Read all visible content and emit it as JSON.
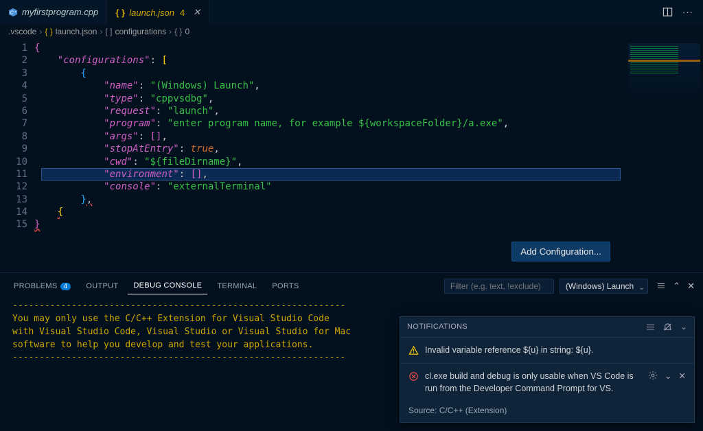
{
  "tabs": [
    {
      "label": "myfirstprogram.cpp",
      "icon": "cpp-icon",
      "active": false
    },
    {
      "label": "launch.json",
      "icon": "json-icon",
      "badge": "4",
      "active": true
    }
  ],
  "breadcrumb": [
    ".vscode",
    "launch.json",
    "configurations",
    "0"
  ],
  "code": {
    "lines": [
      "{",
      "    \"configurations\": [",
      "        {",
      "            \"name\": \"(Windows) Launch\",",
      "            \"type\": \"cppvsdbg\",",
      "            \"request\": \"launch\",",
      "            \"program\": \"enter program name, for example ${workspaceFolder}/a.exe\",",
      "            \"args\": [],",
      "            \"stopAtEntry\": true,",
      "            \"cwd\": \"${fileDirname}\",",
      "            \"environment\": [],",
      "            \"console\": \"externalTerminal\"",
      "        },",
      "    {",
      "}"
    ]
  },
  "addConfigButton": "Add Configuration...",
  "panel": {
    "tabs": [
      "PROBLEMS",
      "OUTPUT",
      "DEBUG CONSOLE",
      "TERMINAL",
      "PORTS"
    ],
    "activeTab": "DEBUG CONSOLE",
    "problemsCount": "4",
    "filterPlaceholder": "Filter (e.g. text, !exclude)",
    "launchConfig": "(Windows) Launch"
  },
  "console": {
    "dash": "--------------------------------------------------------------",
    "l1": "You may only use the C/C++ Extension for Visual Studio Code",
    "l2": "with Visual Studio Code, Visual Studio or Visual Studio for Mac",
    "l3": "software to help you develop and test your applications."
  },
  "notifications": {
    "title": "NOTIFICATIONS",
    "items": [
      {
        "kind": "warn",
        "text": "Invalid variable reference ${u} in string: ${u}."
      },
      {
        "kind": "error",
        "text": "cl.exe build and debug is only usable when VS Code is run from the Developer Command Prompt for VS."
      }
    ],
    "source": "Source: C/C++ (Extension)"
  }
}
